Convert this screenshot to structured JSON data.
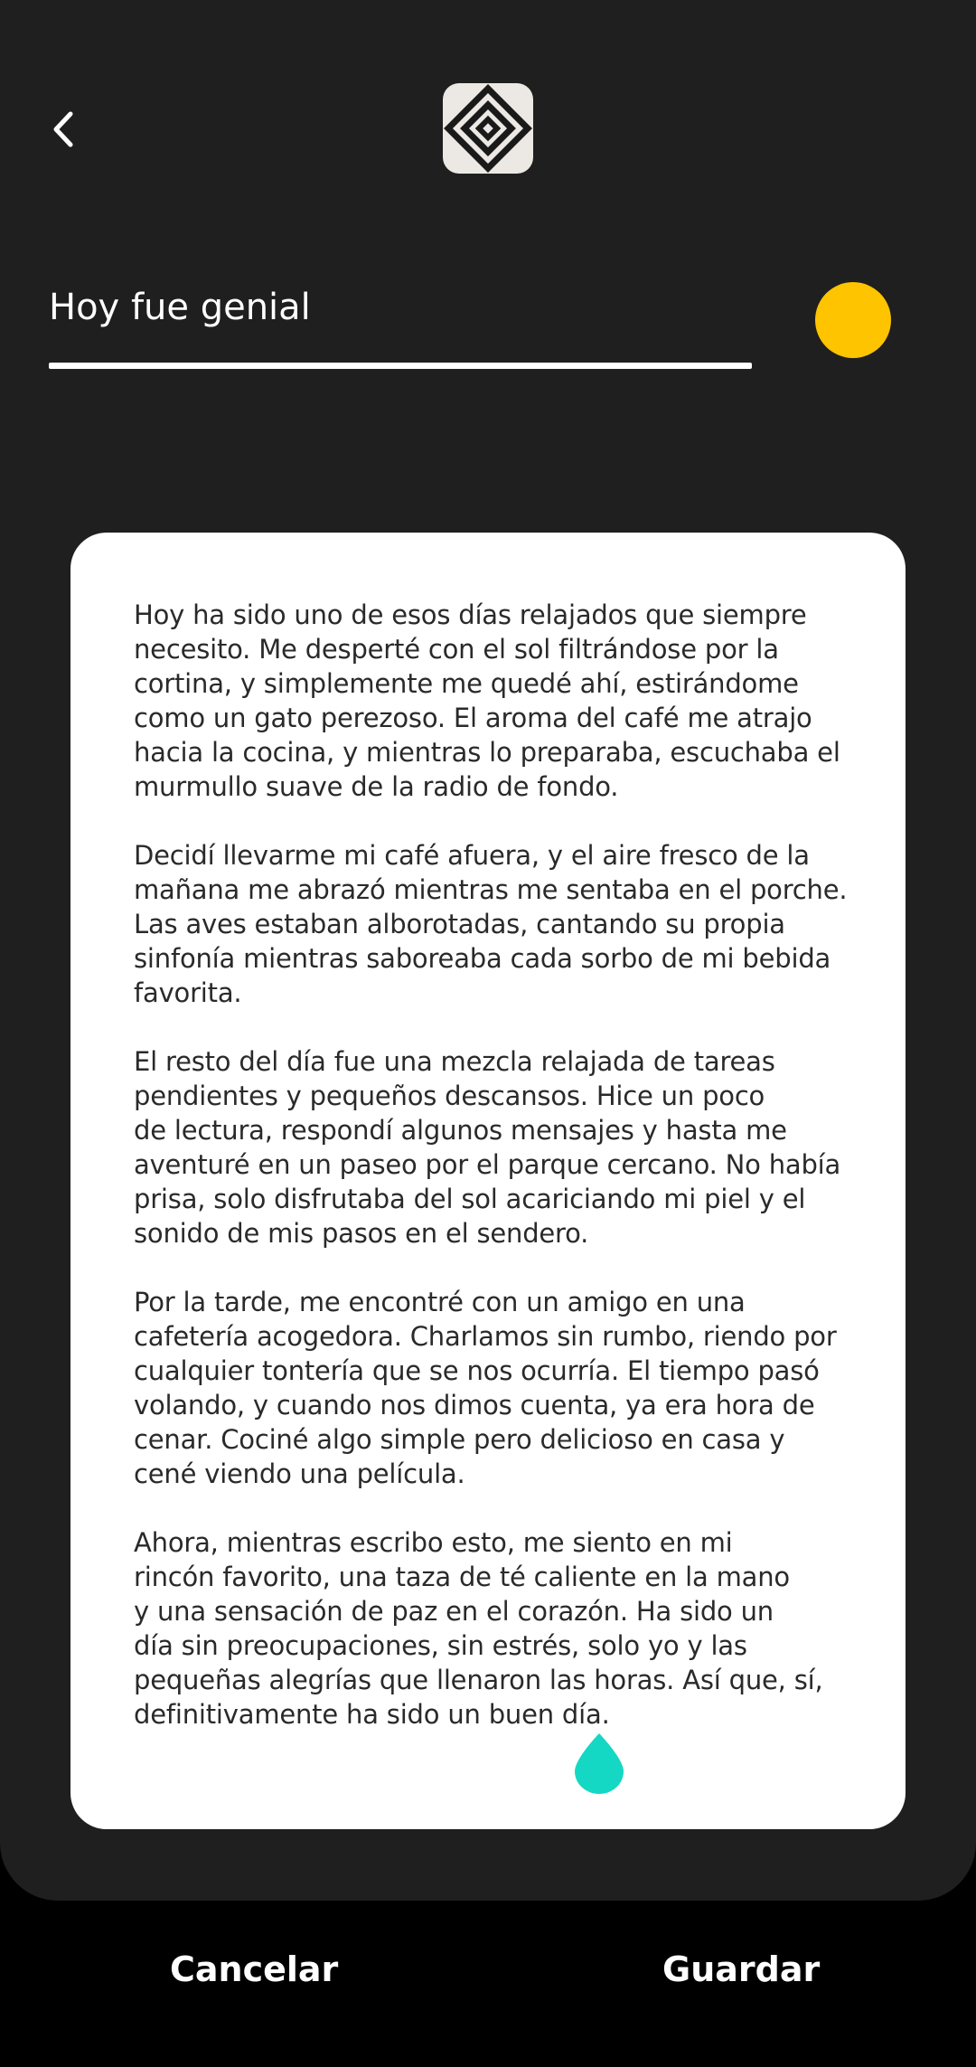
{
  "header": {
    "back_icon": "chevron-left-icon",
    "logo_icon": "concentric-diamonds-logo"
  },
  "entry": {
    "title": "Hoy fue genial",
    "mood_color": "#ffc400",
    "paragraphs": [
      "Hoy ha sido uno de esos días relajados que siempre\nnecesito. Me desperté con el sol filtrándose por la\ncortina, y simplemente me quedé ahí, estirándome\ncomo un gato perezoso. El aroma del café me atrajo\nhacia la cocina, y mientras lo preparaba, escuchaba el\nmurmullo suave de la radio de fondo.",
      "Decidí llevarme mi café afuera, y el aire fresco de la\nmañana me abrazó mientras me sentaba en el porche.\nLas aves estaban alborotadas, cantando su propia\nsinfonía mientras saboreaba cada sorbo de mi bebida\nfavorita.",
      "El resto del día fue una mezcla relajada de tareas\npendientes y pequeños descansos. Hice un poco\nde lectura, respondí algunos mensajes y hasta me\naventuré en un paseo por el parque cercano. No había\nprisa, solo disfrutaba del sol acariciando mi piel y el\nsonido de mis pasos en el sendero.",
      "Por la tarde, me encontré con un amigo en una\ncafetería acogedora. Charlamos sin rumbo, riendo por\ncualquier tontería que se nos ocurría. El tiempo pasó\nvolando, y cuando nos dimos cuenta, ya era hora de\ncenar. Cociné algo simple pero delicioso en casa y\ncené viendo una película.",
      "Ahora, mientras escribo esto, me siento en mi\nrincón favorito, una taza de té caliente en la mano\ny una sensación de paz en el corazón. Ha sido un\ndía sin preocupaciones, sin estrés, solo yo y las\npequeñas alegrías que llenaron las horas. Así que, sí,\ndefinitivamente ha sido un buen día."
    ],
    "cursor_handle_color": "#14d8c4"
  },
  "footer": {
    "cancel_label": "Cancelar",
    "save_label": "Guardar"
  }
}
